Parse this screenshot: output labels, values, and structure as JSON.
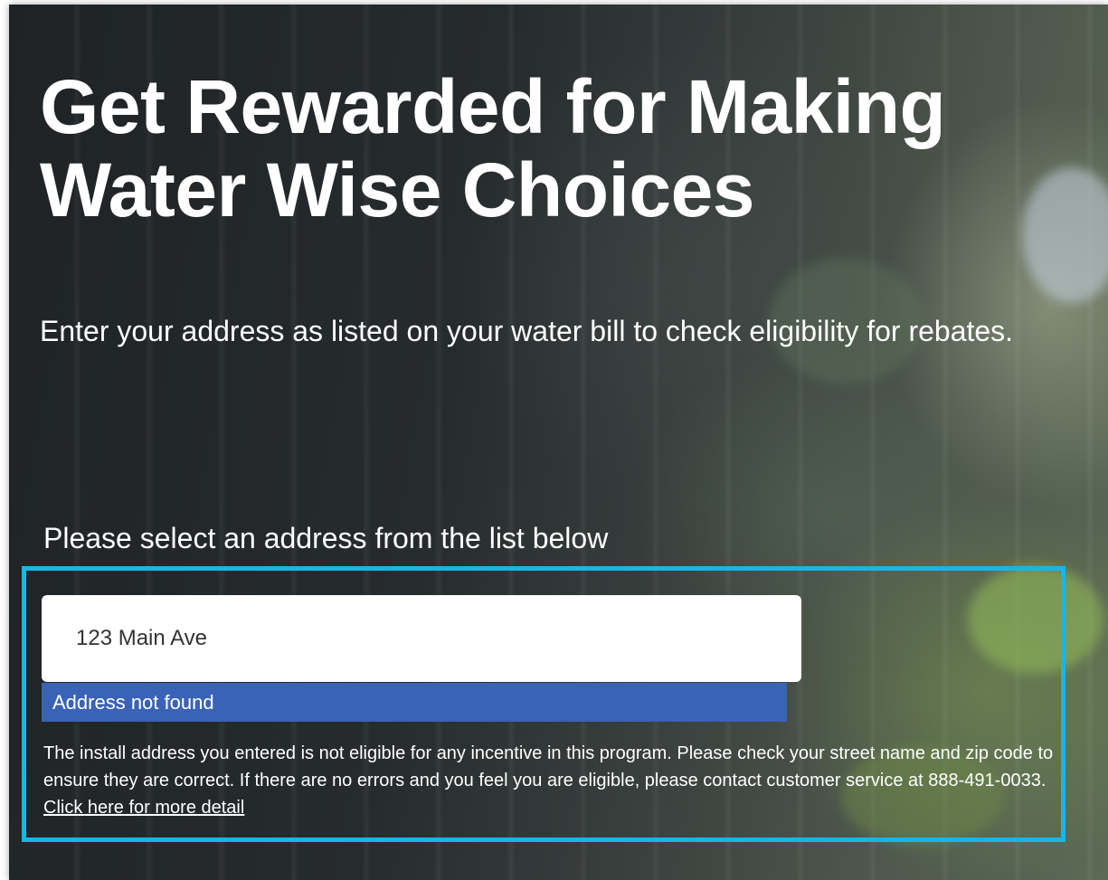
{
  "hero": {
    "title": "Get Rewarded for Making Water Wise Choices",
    "intro": "Enter your address as listed on your water bill to check eligibility for rebates."
  },
  "address_search": {
    "label": "Please select an address from the list below",
    "value": "123 Main Ave",
    "suggestion": "Address not found",
    "error_message": "The install address you entered is not eligible for any incentive in this program. Please check your street name and zip code to ensure they are correct. If there are no errors and you feel you are eligible, please contact customer service at 888-491-0033.",
    "detail_link": "Click here for more detail"
  },
  "colors": {
    "highlight_border": "#17b6e6",
    "suggestion_bg": "#3a63b5"
  }
}
